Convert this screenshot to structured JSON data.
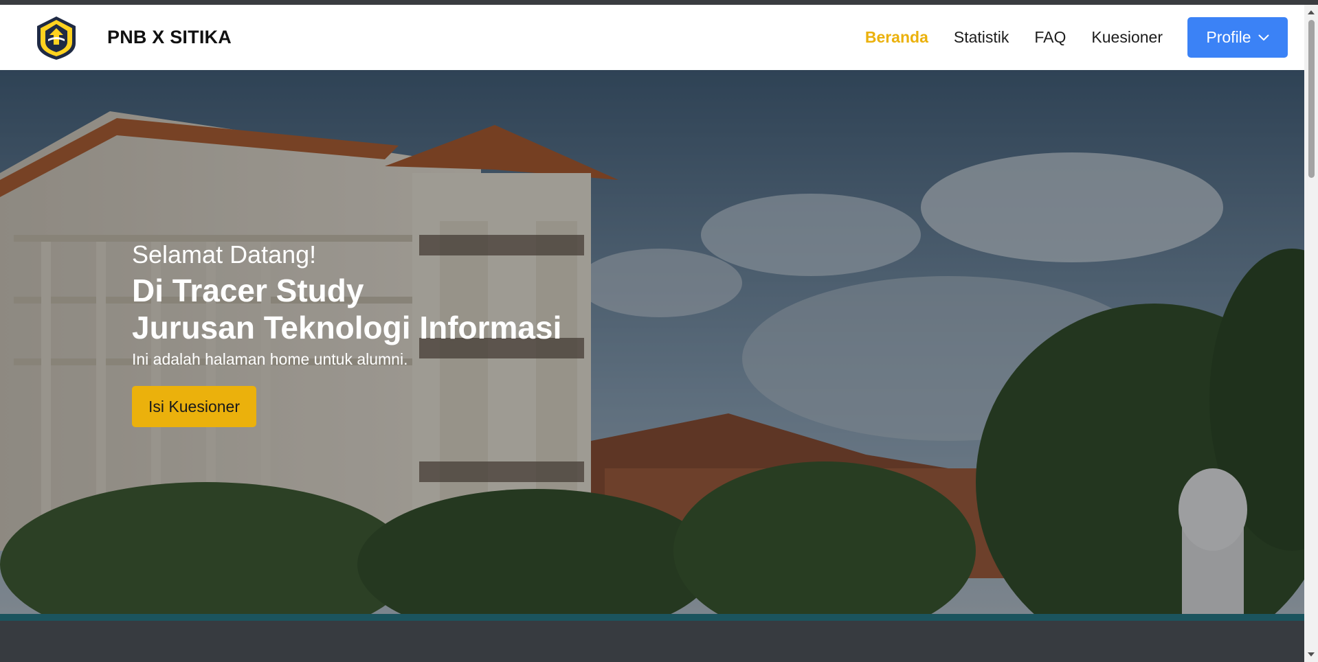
{
  "brand": {
    "name": "PNB X SITIKA",
    "logo_icon": "pnb-emblem-icon"
  },
  "nav": {
    "items": [
      {
        "label": "Beranda",
        "active": true
      },
      {
        "label": "Statistik",
        "active": false
      },
      {
        "label": "FAQ",
        "active": false
      },
      {
        "label": "Kuesioner",
        "active": false
      }
    ],
    "profile_label": "Profile",
    "profile_icon": "chevron-down-icon"
  },
  "hero": {
    "greeting": "Selamat Datang!",
    "headline_line1": "Di Tracer Study",
    "headline_line2": "Jurusan Teknologi Informasi",
    "subtext": "Ini adalah halaman home untuk alumni.",
    "cta_label": "Isi Kuesioner",
    "background_image": "campus-building-photo"
  },
  "colors": {
    "accent": "#ebb10c",
    "primary": "#3b82f6",
    "navbar_bg": "#ffffff"
  }
}
